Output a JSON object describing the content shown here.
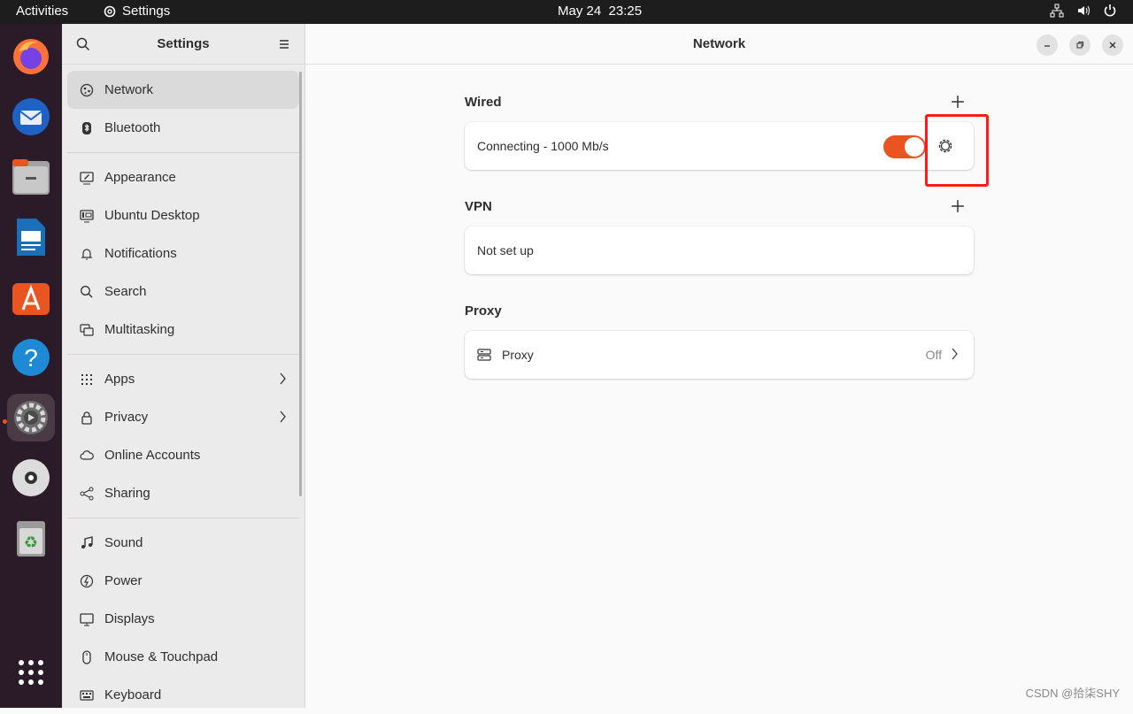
{
  "topbar": {
    "activities": "Activities",
    "app_name": "Settings",
    "date": "May 24",
    "time": "23:25"
  },
  "sidebar": {
    "title": "Settings",
    "items": [
      {
        "label": "Network",
        "icon": "network-icon",
        "selected": true
      },
      {
        "label": "Bluetooth",
        "icon": "bluetooth-icon"
      },
      {
        "label": "Appearance",
        "icon": "appearance-icon"
      },
      {
        "label": "Ubuntu Desktop",
        "icon": "ubuntu-desktop-icon"
      },
      {
        "label": "Notifications",
        "icon": "bell-icon"
      },
      {
        "label": "Search",
        "icon": "search-icon"
      },
      {
        "label": "Multitasking",
        "icon": "multitasking-icon"
      },
      {
        "label": "Apps",
        "icon": "apps-grid-icon"
      },
      {
        "label": "Privacy",
        "icon": "lock-icon"
      },
      {
        "label": "Online Accounts",
        "icon": "cloud-icon"
      },
      {
        "label": "Sharing",
        "icon": "share-icon"
      },
      {
        "label": "Sound",
        "icon": "music-note-icon"
      },
      {
        "label": "Power",
        "icon": "power-icon"
      },
      {
        "label": "Displays",
        "icon": "display-icon"
      },
      {
        "label": "Mouse & Touchpad",
        "icon": "mouse-icon"
      },
      {
        "label": "Keyboard",
        "icon": "keyboard-icon"
      }
    ]
  },
  "main": {
    "title": "Network",
    "wired": {
      "heading": "Wired",
      "status": "Connecting - 1000 Mb/s",
      "enabled": true
    },
    "vpn": {
      "heading": "VPN",
      "status": "Not set up"
    },
    "proxy": {
      "heading": "Proxy",
      "label": "Proxy",
      "status": "Off"
    }
  },
  "watermark": "CSDN @拾柒SHY",
  "colors": {
    "accent": "#e95420",
    "highlight_box": "#ff1a1a",
    "dock_bg": "#2b1a27",
    "topbar_bg": "#1d1d1d"
  }
}
